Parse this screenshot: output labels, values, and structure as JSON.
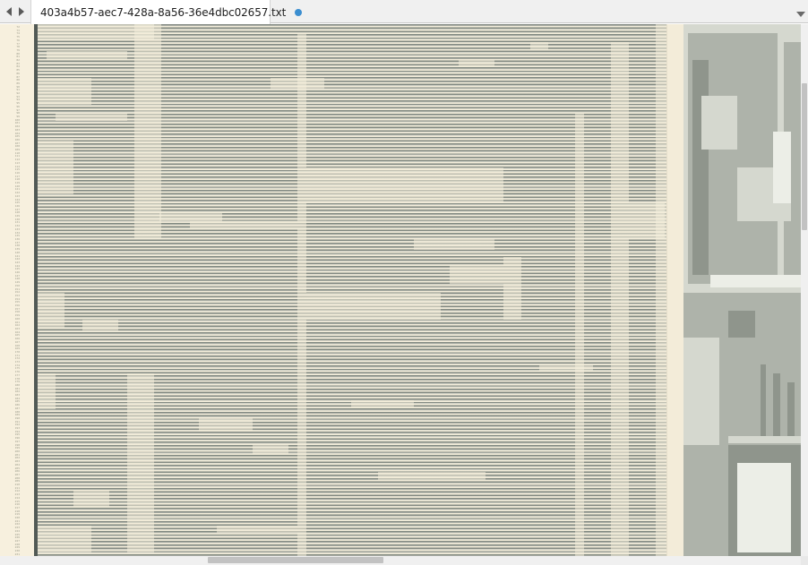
{
  "tab": {
    "title": "403a4b57-aec7-428a-8a56-36e4dbc02657.txt",
    "dirty": true
  },
  "icons": {
    "back": "chevron-left-icon",
    "forward": "chevron-right-icon",
    "tab_menu": "chevron-down-icon",
    "dirty": "unsaved-dot-icon"
  },
  "colors": {
    "dirty_dot": "#3b8ed0",
    "editor_background": "#f3edda",
    "text_ink": "#6f7873"
  },
  "editor": {
    "first_line_number": 72,
    "last_line_number": 232
  },
  "scroll": {
    "vertical_position": 0.11,
    "horizontal_position": 0.26
  }
}
